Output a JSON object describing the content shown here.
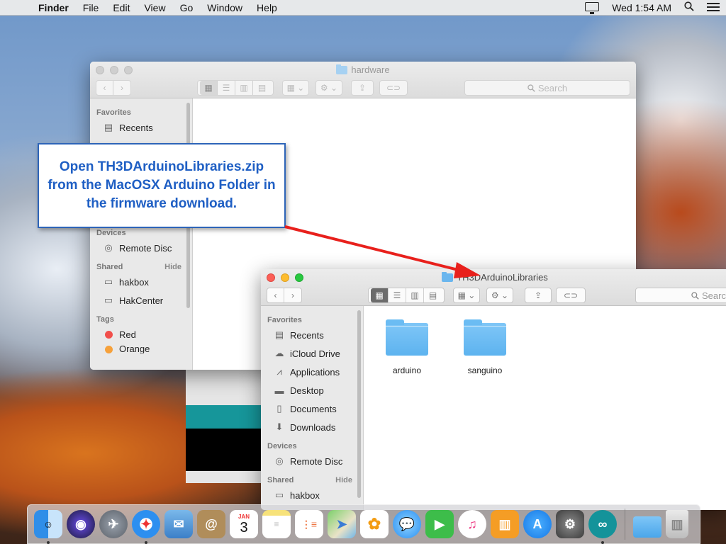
{
  "menubar": {
    "app_name": "Finder",
    "menus": [
      "File",
      "Edit",
      "View",
      "Go",
      "Window",
      "Help"
    ],
    "clock": "Wed 1:54 AM"
  },
  "back_window": {
    "title": "hardware",
    "search_placeholder": "Search",
    "sidebar": {
      "favorites_header": "Favorites",
      "recents": "Recents",
      "devices_header": "Devices",
      "remote_disc": "Remote Disc",
      "shared_header": "Shared",
      "shared_hide": "Hide",
      "shared_items": [
        "hakbox",
        "HakCenter"
      ],
      "tags_header": "Tags",
      "tag_red": "Red",
      "tag_orange": "Orange"
    }
  },
  "front_window": {
    "title": "TH3DArduinoLibraries",
    "search_placeholder": "Search",
    "sidebar": {
      "favorites_header": "Favorites",
      "favorites": [
        "Recents",
        "iCloud Drive",
        "Applications",
        "Desktop",
        "Documents",
        "Downloads"
      ],
      "devices_header": "Devices",
      "remote_disc": "Remote Disc",
      "shared_header": "Shared",
      "shared_hide": "Hide",
      "shared_item": "hakbox"
    },
    "items": [
      "arduino",
      "sanguino"
    ]
  },
  "callout": {
    "text": "Open TH3DArduinoLibraries.zip from the MacOSX Arduino Folder in the firmware download."
  },
  "dock": {
    "apps": [
      "Finder",
      "Siri",
      "Launchpad",
      "Safari",
      "Mail",
      "Contacts",
      "Calendar",
      "Notes",
      "Reminders",
      "Maps",
      "Photos",
      "Messages",
      "FaceTime",
      "iTunes",
      "iBooks",
      "App Store",
      "System Preferences",
      "Arduino"
    ],
    "calendar_month": "JAN",
    "calendar_day": "3",
    "extras": [
      "Downloads Folder",
      "Trash"
    ]
  }
}
